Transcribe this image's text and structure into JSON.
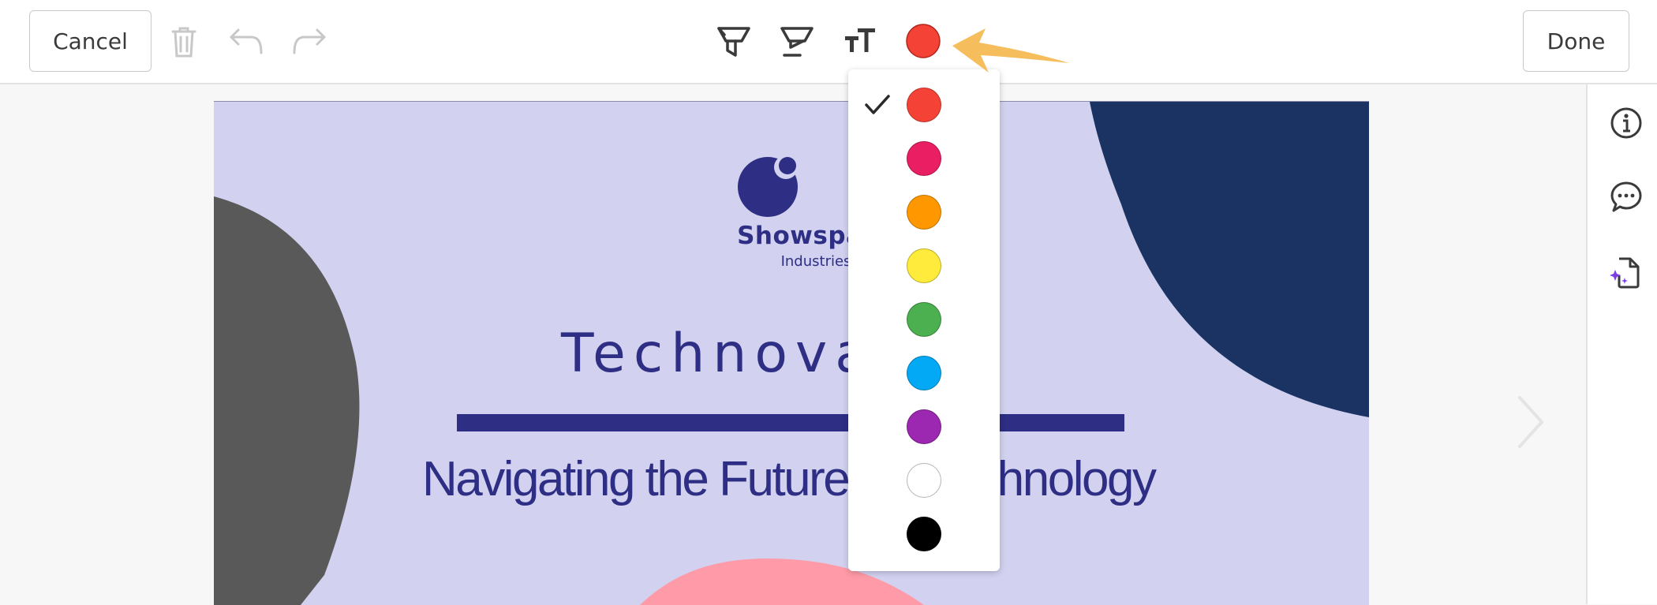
{
  "toolbar": {
    "cancel_label": "Cancel",
    "done_label": "Done",
    "selected_color": "#f44336"
  },
  "slide": {
    "logo_name": "Showspace",
    "logo_sub": "Industries",
    "title": "Technovat",
    "subtitle": "Navigating the Future",
    "subtitle_tail": "chnology"
  },
  "color_menu": {
    "selected_index": 0,
    "colors": [
      "#f44336",
      "#e91e63",
      "#ff9800",
      "#ffeb3b",
      "#4caf50",
      "#03a9f4",
      "#9c27b0",
      "#ffffff",
      "#000000"
    ]
  }
}
